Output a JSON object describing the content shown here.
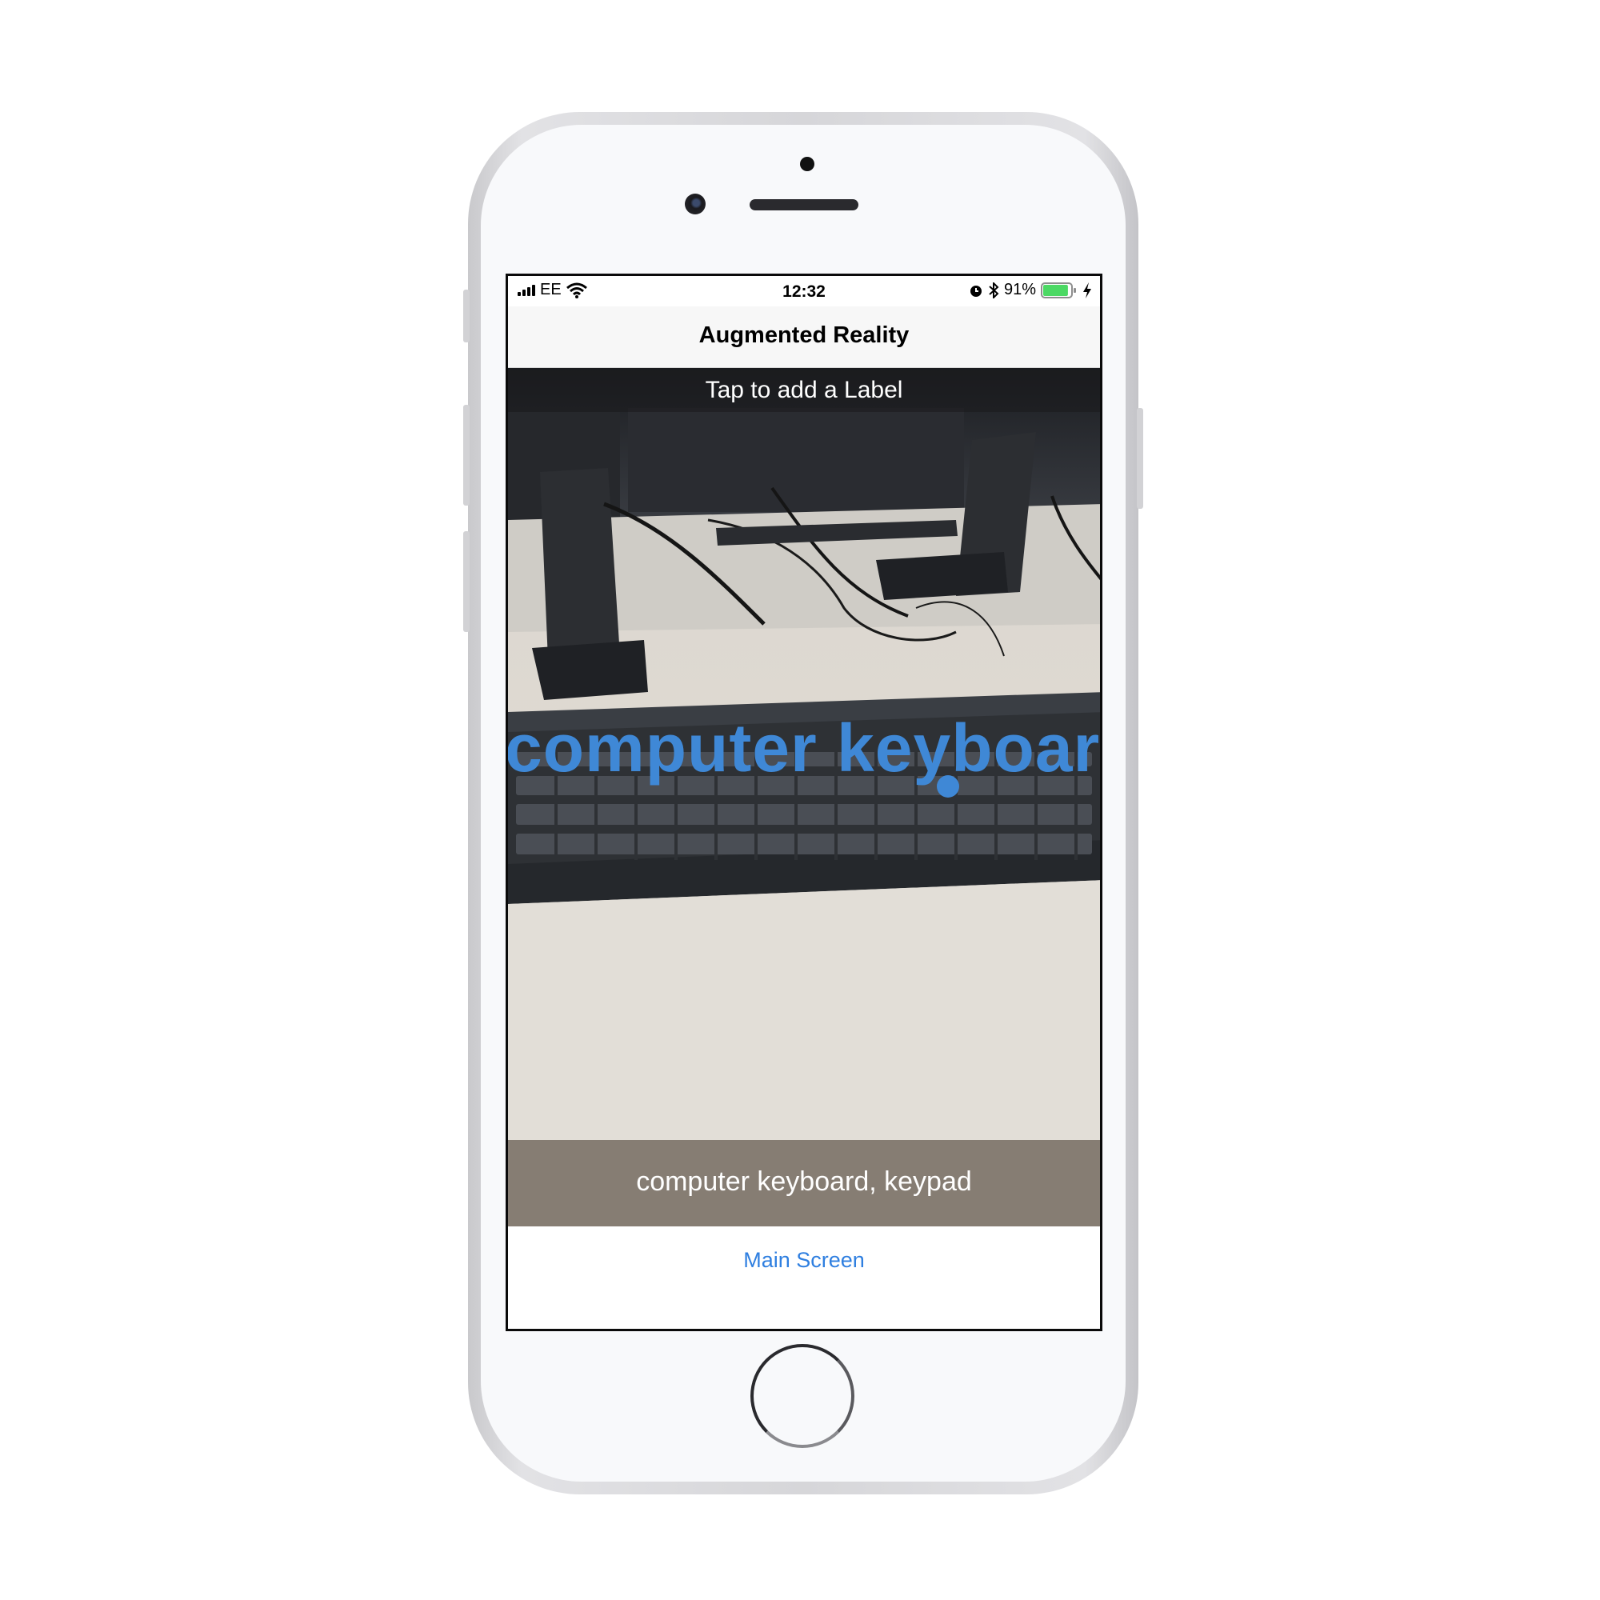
{
  "status": {
    "carrier": "EE",
    "time": "12:32",
    "battery": "91%",
    "battery_level": 0.91
  },
  "nav": {
    "title": "Augmented Reality"
  },
  "ar": {
    "hint": "Tap to add a Label",
    "label": "computer keyboard",
    "accent_color": "#3f88d6"
  },
  "classification": {
    "text": "computer keyboard, keypad"
  },
  "footer": {
    "main_button": "Main Screen",
    "link_color": "#2f7fe0"
  }
}
